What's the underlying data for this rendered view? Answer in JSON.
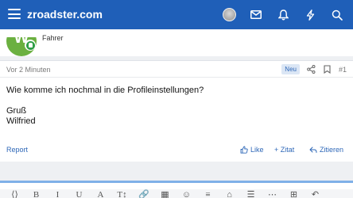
{
  "header": {
    "logo": "zroadster.com",
    "icons": [
      "menu-icon",
      "user-avatar",
      "mail-icon",
      "bell-icon",
      "bolt-icon",
      "search-icon"
    ],
    "color": "#1f5fb8"
  },
  "author": {
    "initial": "W",
    "role": "Fahrer",
    "avatar_color": "#6bb040",
    "online_color": "#2e9e46"
  },
  "post": {
    "time": "Vor 2 Minuten",
    "badge": "Neu",
    "number": "#1",
    "lines": [
      "Wie komme ich nochmal in die Profileinstellungen?",
      "",
      "Gruß",
      "Wilfried"
    ],
    "report": "Report",
    "like": "Like",
    "quote": "+ Zitat",
    "reply": "Zitieren"
  },
  "editor": {
    "tools": [
      "⟨⟩",
      "B",
      "I",
      "U",
      "A",
      "T↕",
      "🔗",
      "▦",
      "☺",
      "≡",
      "⌂",
      "☰",
      "⋯",
      "⊞",
      "↶"
    ]
  }
}
